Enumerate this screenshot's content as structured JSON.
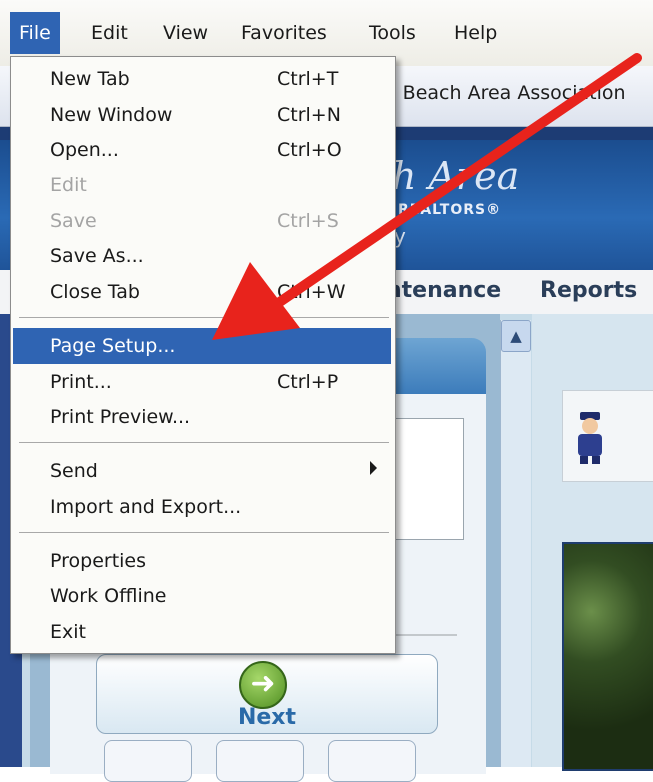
{
  "menubar": {
    "items": [
      "File",
      "Edit",
      "View",
      "Favorites",
      "Tools",
      "Help"
    ],
    "active": "File"
  },
  "background_page": {
    "tab_title": "a Beach Area Association",
    "logo_line1": "h Area",
    "logo_line2": "REALTORS®",
    "logo_line3": "y",
    "nav_items": [
      "ntenance",
      "Reports"
    ],
    "next_label": "Next",
    "scroll_up_glyph": "▲"
  },
  "file_menu": {
    "items": [
      {
        "label": "New Tab",
        "shortcut": "Ctrl+T",
        "enabled": true
      },
      {
        "label": "New Window",
        "shortcut": "Ctrl+N",
        "enabled": true
      },
      {
        "label": "Open...",
        "shortcut": "Ctrl+O",
        "enabled": true
      },
      {
        "label": "Edit",
        "shortcut": "",
        "enabled": false
      },
      {
        "label": "Save",
        "shortcut": "Ctrl+S",
        "enabled": false
      },
      {
        "label": "Save As...",
        "shortcut": "",
        "enabled": true
      },
      {
        "label": "Close Tab",
        "shortcut": "Ctrl+W",
        "enabled": true
      },
      {
        "label": "Page Setup...",
        "shortcut": "",
        "enabled": true,
        "highlighted": true
      },
      {
        "label": "Print...",
        "shortcut": "Ctrl+P",
        "enabled": true
      },
      {
        "label": "Print Preview...",
        "shortcut": "",
        "enabled": true
      },
      {
        "label": "Send",
        "shortcut": "",
        "enabled": true,
        "submenu": true
      },
      {
        "label": "Import and Export...",
        "shortcut": "",
        "enabled": true
      },
      {
        "label": "Properties",
        "shortcut": "",
        "enabled": true
      },
      {
        "label": "Work Offline",
        "shortcut": "",
        "enabled": true
      },
      {
        "label": "Exit",
        "shortcut": "",
        "enabled": true
      }
    ]
  },
  "colors": {
    "menu_highlight": "#2f64b3",
    "annotation_arrow": "#e8231c",
    "disabled_text": "#a4a4a4"
  },
  "annotation": {
    "type": "arrow",
    "points_to": "Page Setup..."
  }
}
